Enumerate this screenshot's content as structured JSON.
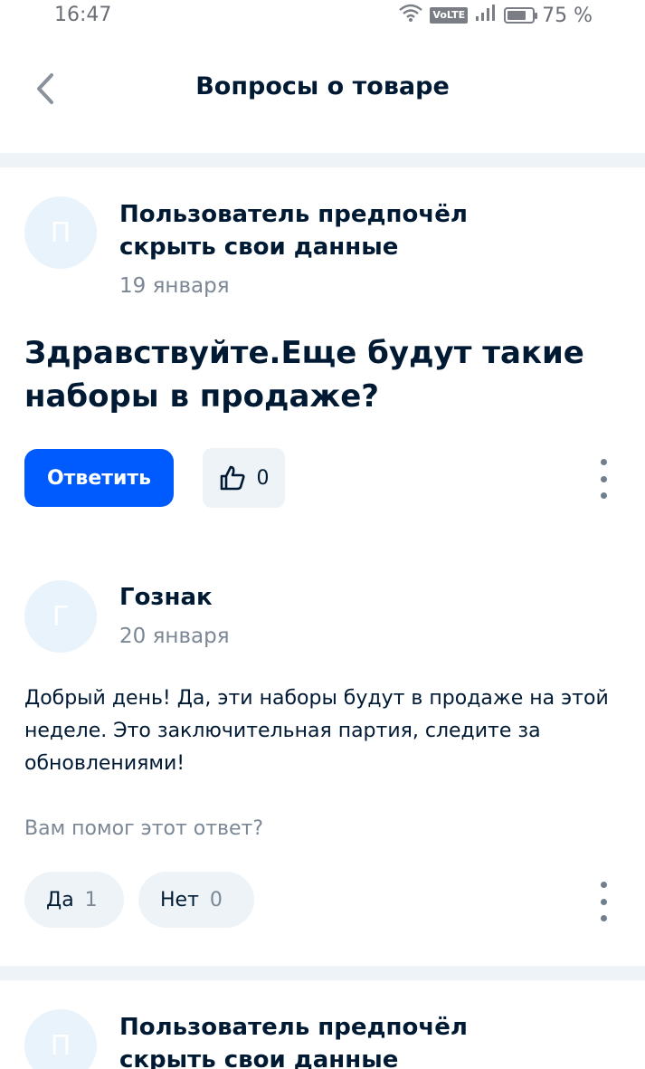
{
  "status_bar": {
    "time": "16:47",
    "battery": "75 %",
    "volte": "VoLTE",
    "battery_level": 0.75
  },
  "header": {
    "title": "Вопросы о товаре"
  },
  "questions": [
    {
      "avatar_letter": "П",
      "author": "Пользователь предпочёл скрыть свои данные",
      "date": "19 января",
      "text": "Здравствуйте.Еще будут такие наборы в продаже?",
      "reply_label": "Ответить",
      "likes": "0",
      "answer": {
        "avatar_letter": "Г",
        "author": "Гознак",
        "date": "20 января",
        "text": "Добрый день! Да, эти наборы будут в продаже на этой неделе. Это заключительная партия, следите за обновлениями!",
        "helpful_question": "Вам помог этот ответ?",
        "yes_label": "Да",
        "yes_count": "1",
        "no_label": "Нет",
        "no_count": "0"
      }
    },
    {
      "avatar_letter": "П",
      "author": "Пользователь предпочёл скрыть свои данные"
    }
  ],
  "colors": {
    "accent": "#005bff",
    "avatar_bg": "#e8f3fb",
    "muted": "#7b8794",
    "divider": "#eef3f8"
  }
}
